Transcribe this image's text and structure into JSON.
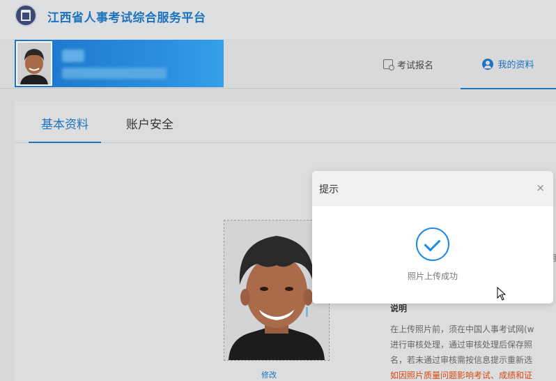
{
  "header": {
    "site_title": "江西省人事考试综合服务平台"
  },
  "user": {
    "name": "张",
    "id": "360000000000000000"
  },
  "nav": {
    "exam_registration": "考试报名",
    "my_profile": "我的资料"
  },
  "tabs": {
    "basic_info": "基本资料",
    "account_security": "账户安全"
  },
  "photo": {
    "modify_label": "修改"
  },
  "notes": {
    "title": "说明",
    "line1": "在上传照片前，须在中国人事考试网(w",
    "line2": "进行审核处理，通过审核处理后保存照",
    "line3": "名，若未通过审核需按信息提示重新选",
    "line4": "如因照片质量问题影响考试、成绩和证",
    "side_char": "用"
  },
  "modal": {
    "title": "提示",
    "close": "×",
    "message": "照片上传成功"
  },
  "colors": {
    "accent": "#1e73be",
    "success": "#1e88e5",
    "warning_text": "#d9480f"
  }
}
